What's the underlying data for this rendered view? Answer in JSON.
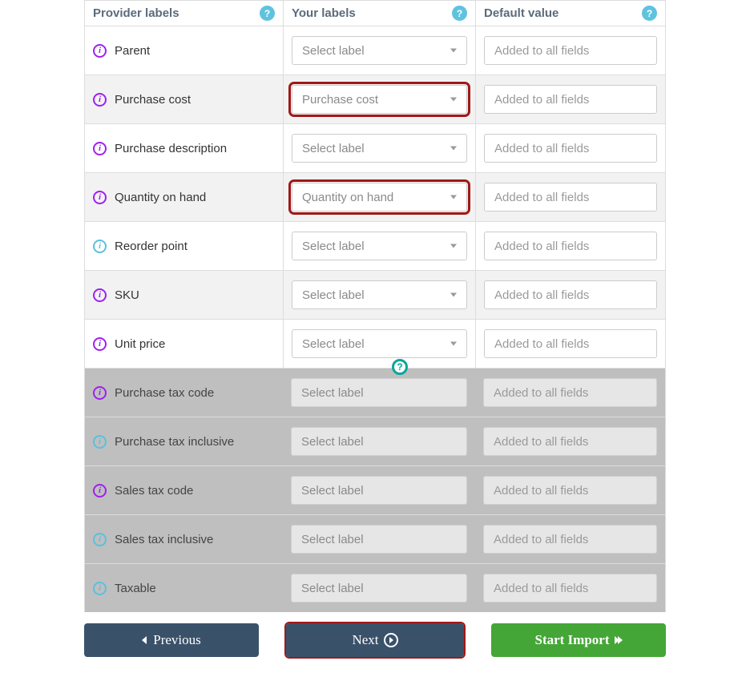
{
  "headers": {
    "provider": "Provider labels",
    "your": "Your labels",
    "default": "Default value"
  },
  "select_placeholder": "Select label",
  "default_placeholder": "Added to all fields",
  "rows": [
    {
      "label": "Parent",
      "icon": "purple",
      "selected": "Select label",
      "highlight": false,
      "alt": false,
      "disabled": false
    },
    {
      "label": "Purchase cost",
      "icon": "purple",
      "selected": "Purchase cost",
      "highlight": true,
      "alt": true,
      "disabled": false
    },
    {
      "label": "Purchase description",
      "icon": "purple",
      "selected": "Select label",
      "highlight": false,
      "alt": false,
      "disabled": false
    },
    {
      "label": "Quantity on hand",
      "icon": "purple",
      "selected": "Quantity on hand",
      "highlight": true,
      "alt": true,
      "disabled": false
    },
    {
      "label": "Reorder point",
      "icon": "blue",
      "selected": "Select label",
      "highlight": false,
      "alt": false,
      "disabled": false
    },
    {
      "label": "SKU",
      "icon": "purple",
      "selected": "Select label",
      "highlight": false,
      "alt": true,
      "disabled": false
    },
    {
      "label": "Unit price",
      "icon": "purple",
      "selected": "Select label",
      "highlight": false,
      "alt": false,
      "disabled": false
    },
    {
      "label": "Purchase tax code",
      "icon": "purple",
      "selected": "Select label",
      "highlight": false,
      "alt": false,
      "disabled": true
    },
    {
      "label": "Purchase tax inclusive",
      "icon": "blue",
      "selected": "Select label",
      "highlight": false,
      "alt": false,
      "disabled": true
    },
    {
      "label": "Sales tax code",
      "icon": "purple",
      "selected": "Select label",
      "highlight": false,
      "alt": false,
      "disabled": true
    },
    {
      "label": "Sales tax inclusive",
      "icon": "blue",
      "selected": "Select label",
      "highlight": false,
      "alt": false,
      "disabled": true
    },
    {
      "label": "Taxable",
      "icon": "blue",
      "selected": "Select label",
      "highlight": false,
      "alt": false,
      "disabled": true
    }
  ],
  "buttons": {
    "previous": "Previous",
    "next": "Next",
    "start": "Start Import"
  }
}
